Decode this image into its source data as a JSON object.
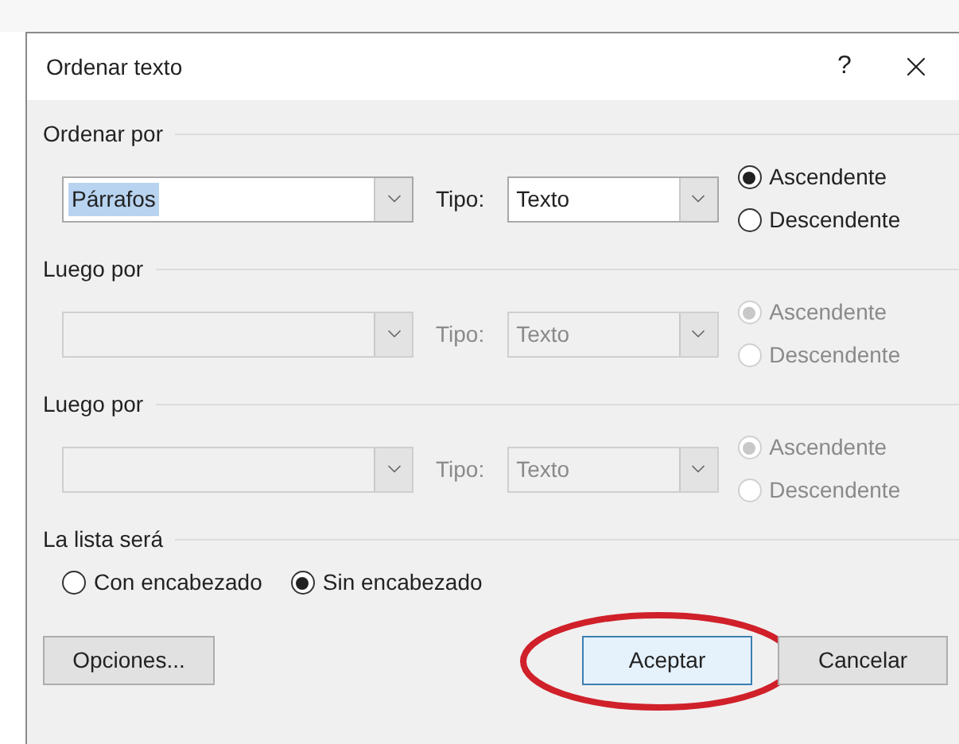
{
  "window": {
    "title": "Ordenar texto",
    "help": "?"
  },
  "sort_keys": [
    {
      "heading": "Ordenar por",
      "disabled": false,
      "field": {
        "value": "Párrafos",
        "highlighted": true
      },
      "type_label": "Tipo:",
      "type_value": "Texto",
      "order": [
        {
          "label": "Ascendente",
          "selected": true
        },
        {
          "label": "Descendente",
          "selected": false
        }
      ]
    },
    {
      "heading": "Luego por",
      "disabled": true,
      "type_label": "Tipo:",
      "type_value": "Texto",
      "order": [
        {
          "label": "Ascendente",
          "selected": true
        },
        {
          "label": "Descendente",
          "selected": false
        }
      ]
    },
    {
      "heading": "Luego por",
      "disabled": true,
      "type_label": "Tipo:",
      "type_value": "Texto",
      "order": [
        {
          "label": "Ascendente",
          "selected": true
        },
        {
          "label": "Descendente",
          "selected": false
        }
      ]
    }
  ],
  "list_header": {
    "heading": "La lista será",
    "options": [
      {
        "label": "Con encabezado",
        "selected": false
      },
      {
        "label": "Sin encabezado",
        "selected": true
      }
    ]
  },
  "buttons": [
    {
      "label": "Opciones...",
      "default": false,
      "circled": false
    },
    {
      "label": "Aceptar",
      "default": true,
      "circled": true
    },
    {
      "label": "Cancelar",
      "default": false,
      "circled": false
    }
  ]
}
